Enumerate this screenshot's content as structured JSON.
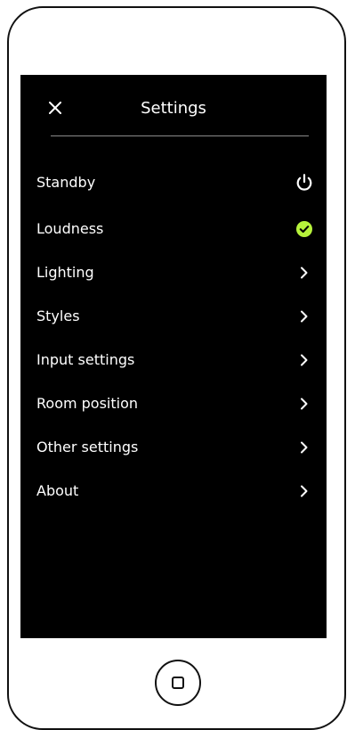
{
  "header": {
    "title": "Settings",
    "close_icon": "close-icon"
  },
  "menu": {
    "items": [
      {
        "label": "Standby",
        "icon": "power-icon"
      },
      {
        "label": "Loudness",
        "icon": "check-circle-icon",
        "checked": true
      },
      {
        "label": "Lighting",
        "icon": "chevron-right-icon"
      },
      {
        "label": "Styles",
        "icon": "chevron-right-icon"
      },
      {
        "label": "Input settings",
        "icon": "chevron-right-icon"
      },
      {
        "label": "Room position",
        "icon": "chevron-right-icon"
      },
      {
        "label": "Other settings",
        "icon": "chevron-right-icon"
      },
      {
        "label": "About",
        "icon": "chevron-right-icon"
      }
    ]
  },
  "device": {
    "home_icon": "home-button-icon"
  },
  "colors": {
    "background": "#000000",
    "text": "#ffffff",
    "accent": "#b6f23b",
    "divider": "#8a8a8a"
  }
}
